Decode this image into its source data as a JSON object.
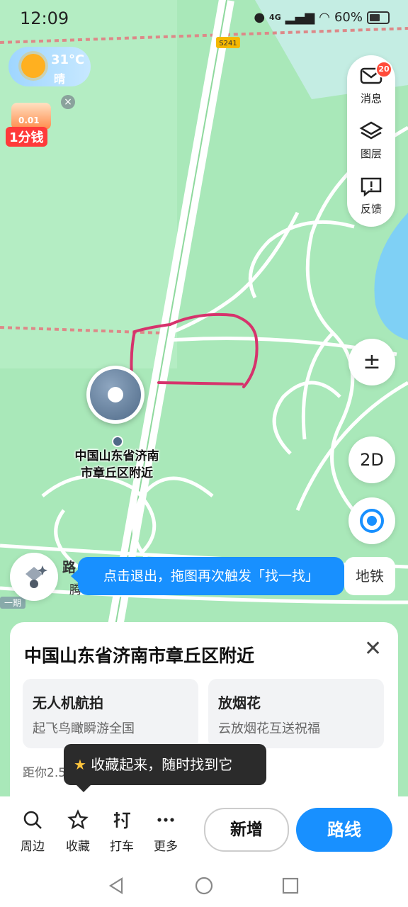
{
  "status_bar": {
    "time": "12:09",
    "network": "4G",
    "battery": "60%"
  },
  "weather": {
    "temperature": "31°C",
    "condition": "晴"
  },
  "promo": {
    "value": "0.01",
    "label": "1分钱"
  },
  "map": {
    "road_shield": "S241",
    "road_label": "路",
    "road_label2": "腾",
    "road_tag": "一期"
  },
  "toolbar": {
    "messages_label": "消息",
    "messages_badge": "20",
    "layers_label": "图层",
    "feedback_label": "反馈"
  },
  "zoom_button": "±",
  "view_mode": "2D",
  "location": {
    "label_line1": "中国山东省济南",
    "label_line2": "市章丘区附近"
  },
  "toast": {
    "text": "点击退出，拖图再次触发「找一找」",
    "subway": "地铁"
  },
  "card": {
    "title": "中国山东省济南市章丘区附近",
    "close": "✕",
    "features": [
      {
        "title": "无人机航拍",
        "subtitle": "起飞鸟瞰瞬游全国"
      },
      {
        "title": "放烟花",
        "subtitle": "云放烟花互送祝福"
      }
    ],
    "distance": "距你2.5公里",
    "tooltip": "收藏起来，随时找到它"
  },
  "actions": [
    {
      "label": "周边",
      "icon": "search-icon"
    },
    {
      "label": "收藏",
      "icon": "star-icon"
    },
    {
      "label": "打车",
      "icon": "taxi-icon"
    },
    {
      "label": "更多",
      "icon": "more-icon"
    }
  ],
  "buttons": {
    "new": "新增",
    "route": "路线"
  },
  "colors": {
    "map_green": "#a9e8b9",
    "accent_blue": "#1890ff",
    "annotation": "#d6336c"
  }
}
